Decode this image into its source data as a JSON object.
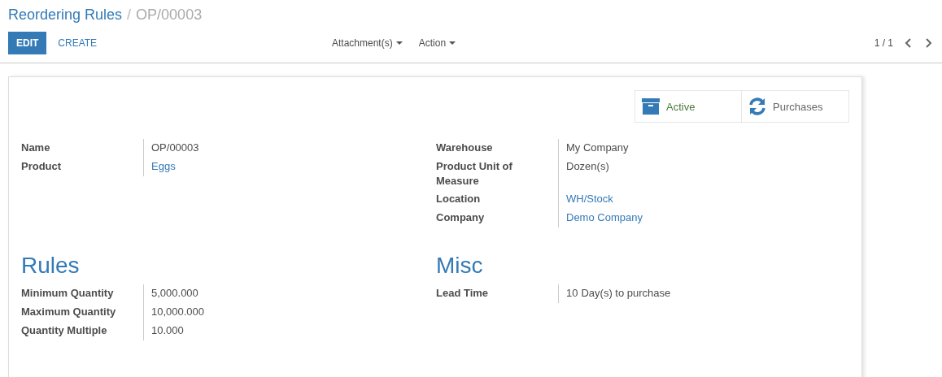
{
  "breadcrumb": {
    "parent": "Reordering Rules",
    "separator": "/",
    "current": "OP/00003"
  },
  "buttons": {
    "edit": "EDIT",
    "create": "CREATE"
  },
  "menus": [
    "Attachment(s)",
    "Action"
  ],
  "pager": {
    "text": "1 / 1"
  },
  "stat_buttons": [
    {
      "kind": "archive",
      "label": "Active",
      "active": true
    },
    {
      "kind": "refresh",
      "label": "Purchases"
    }
  ],
  "top_left": [
    {
      "label": "Name",
      "value": "OP/00003",
      "kind": "text"
    },
    {
      "label": "Product",
      "value": "Eggs",
      "kind": "link"
    }
  ],
  "top_right": [
    {
      "label": "Warehouse",
      "value": "My Company",
      "kind": "text"
    },
    {
      "label": "Product Unit of Measure",
      "value": "Dozen(s)",
      "kind": "text"
    },
    {
      "label": "Location",
      "value": "WH/Stock",
      "kind": "link"
    },
    {
      "label": "Company",
      "value": "Demo Company",
      "kind": "link"
    }
  ],
  "rules": {
    "title": "Rules",
    "fields": [
      {
        "label": "Minimum Quantity",
        "value": "5,000.000"
      },
      {
        "label": "Maximum Quantity",
        "value": "10,000.000"
      },
      {
        "label": "Quantity Multiple",
        "value": "10.000"
      }
    ]
  },
  "misc": {
    "title": "Misc",
    "fields": [
      {
        "label": "Lead Time",
        "value": "10",
        "unit": "Day(s) to purchase"
      }
    ]
  }
}
